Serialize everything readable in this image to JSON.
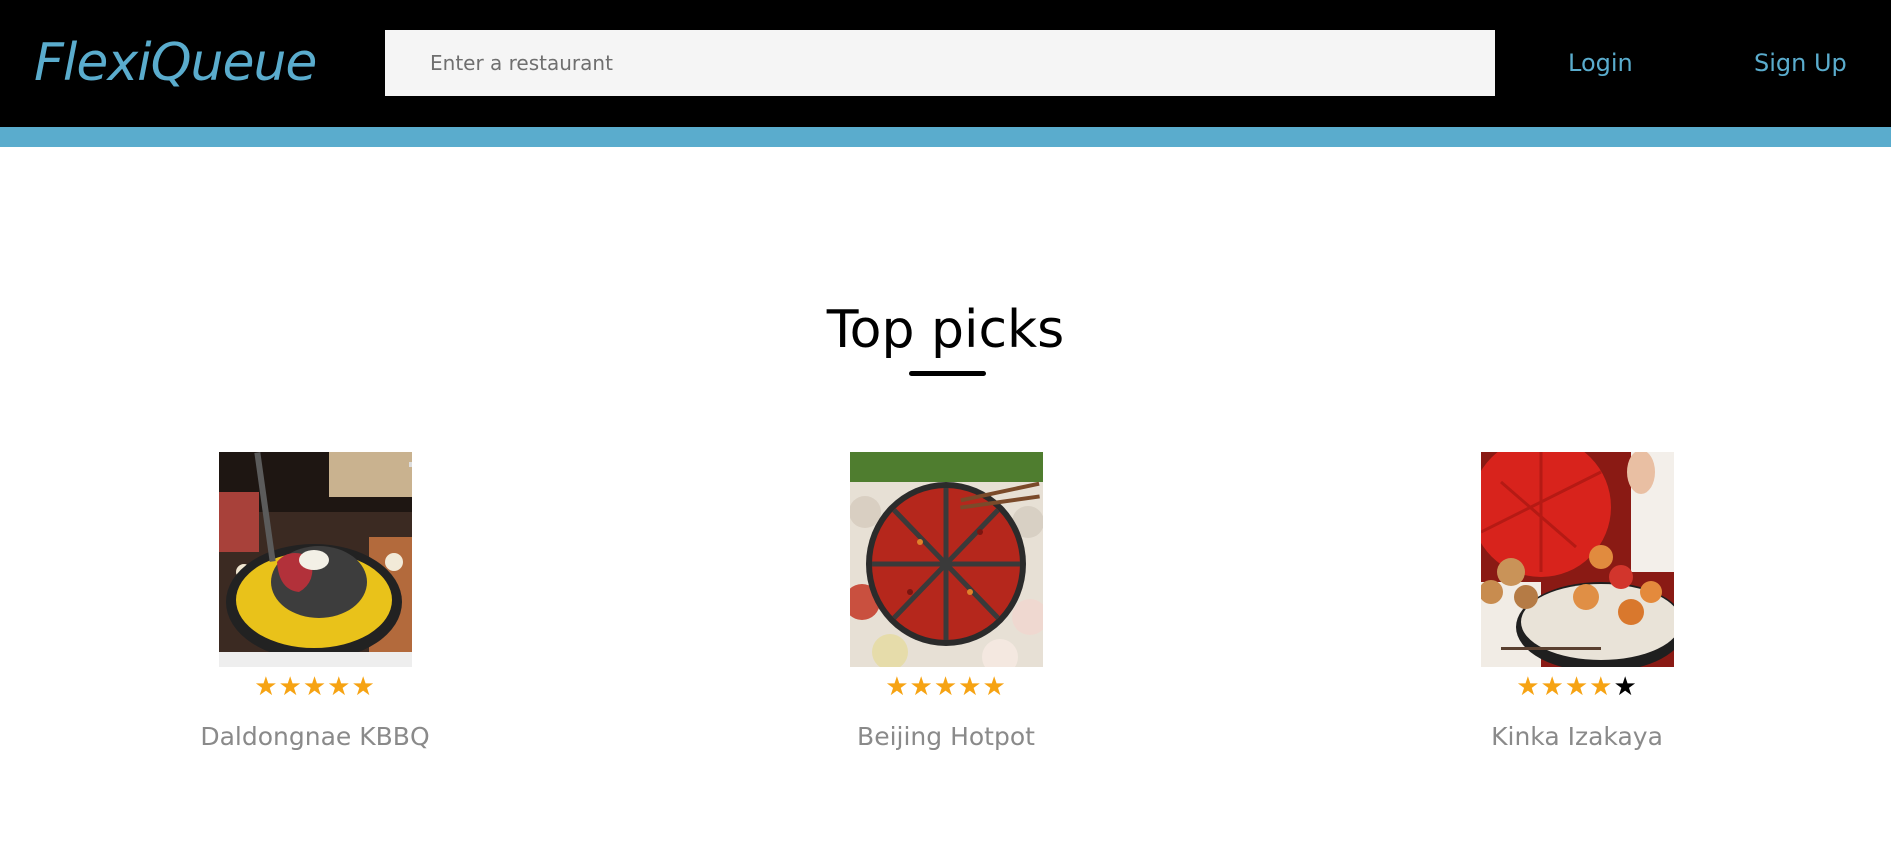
{
  "header": {
    "logo_text": "FlexiQueue",
    "search_placeholder": "Enter a restaurant",
    "login_label": "Login",
    "signup_label": "Sign Up"
  },
  "main": {
    "section_title": "Top picks",
    "restaurants": [
      {
        "name": "Daldongnae KBBQ",
        "rating": 5,
        "max_rating": 5,
        "image_subject": "korean-bbq-grill"
      },
      {
        "name": "Beijing Hotpot",
        "rating": 5,
        "max_rating": 5,
        "image_subject": "hotpot"
      },
      {
        "name": "Kinka Izakaya",
        "rating": 4,
        "max_rating": 5,
        "image_subject": "izakaya-skewers"
      }
    ]
  },
  "colors": {
    "topbar_bg": "#000000",
    "accent": "#5aaccd",
    "star_filled": "#f6a313",
    "star_empty": "#000000",
    "restaurant_name": "#8a8a8a"
  }
}
